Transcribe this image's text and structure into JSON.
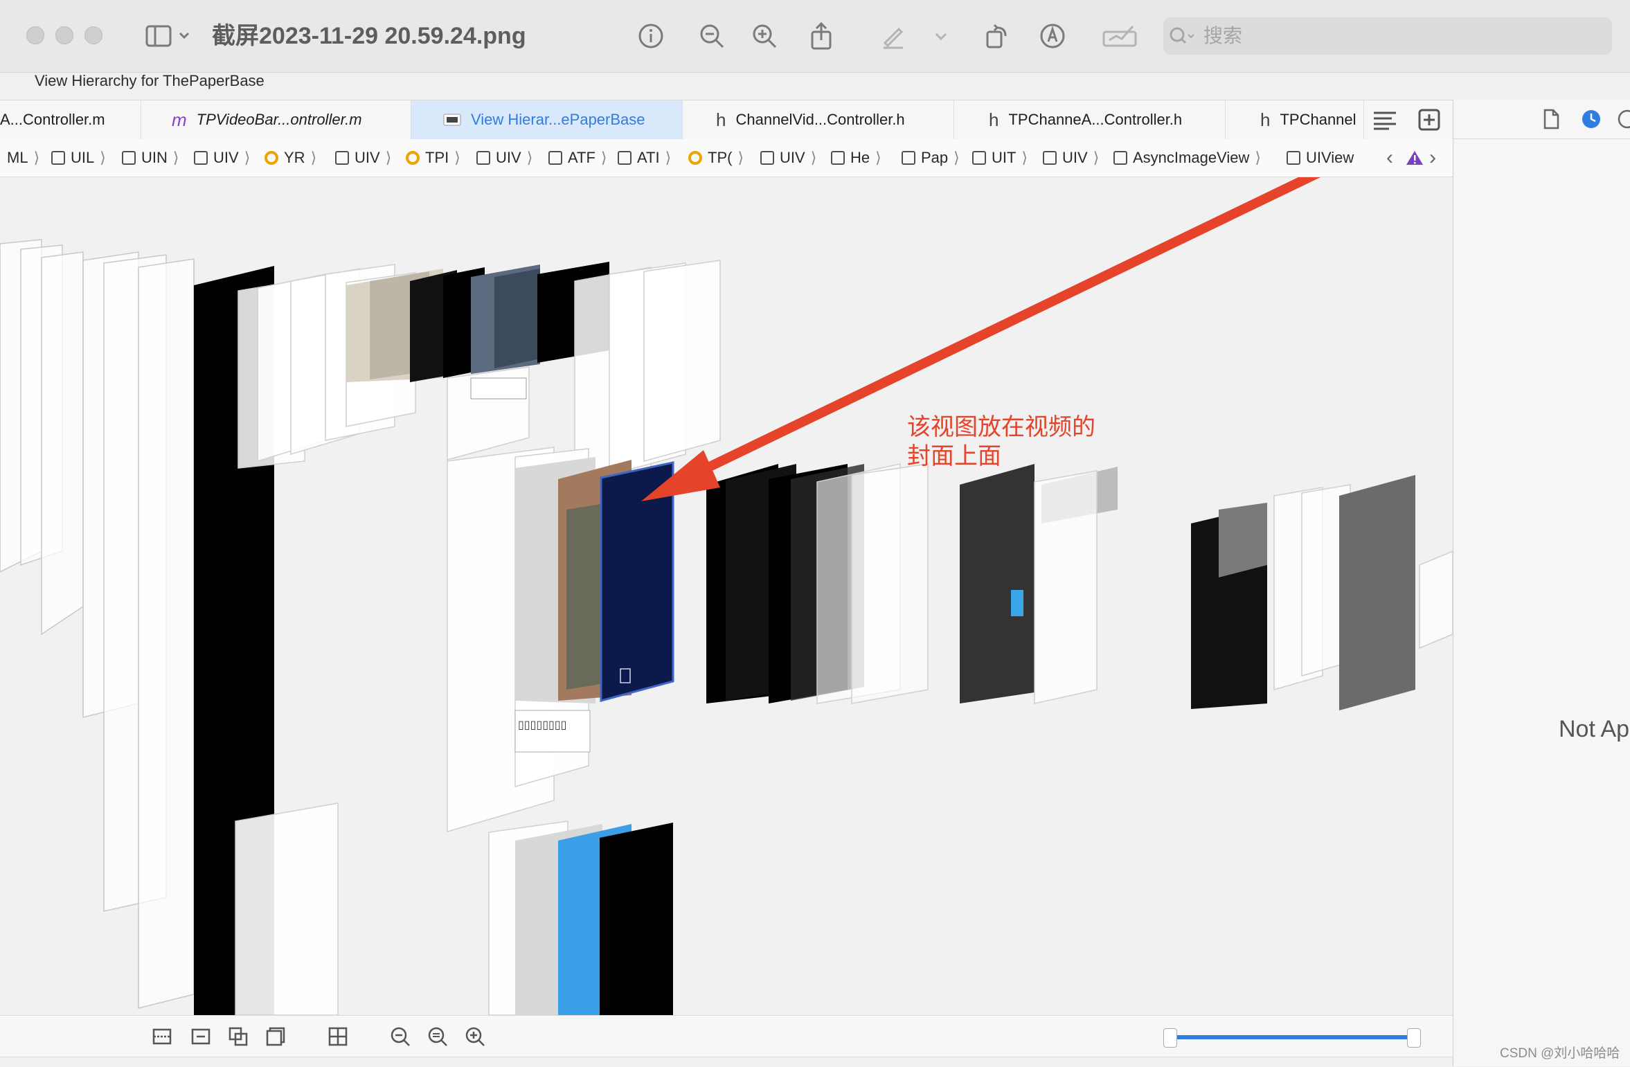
{
  "window": {
    "file_title": "截屏2023-11-29 20.59.24.png",
    "search_placeholder": "搜索",
    "subtitle": "View Hierarchy for ThePaperBase"
  },
  "tabs": [
    {
      "icon": "",
      "label": "A...Controller.m"
    },
    {
      "icon": "m",
      "label": "TPVideoBar...ontroller.m"
    },
    {
      "icon": "",
      "label": "View Hierar...ePaperBase"
    },
    {
      "icon": "h",
      "label": "ChannelVid...Controller.h"
    },
    {
      "icon": "h",
      "label": "TPChanneA...Controller.h"
    },
    {
      "icon": "h",
      "label": "TPChannel"
    }
  ],
  "breadcrumbs": [
    "ML",
    "UIL",
    "UIN",
    "UIV",
    "YR",
    "UIV",
    "TPI",
    "UIV",
    "ATF",
    "ATI",
    "TP(",
    "UIV",
    "He",
    "Pap",
    "UIT",
    "UIV",
    "AsyncImageView",
    "UIView"
  ],
  "annotation": {
    "line1": "该视图放在视频的",
    "line2": "封面上面",
    "color": "#e5432a"
  },
  "inspector": {
    "not_applicable": "Not Ap"
  },
  "watermark": "CSDN @刘小哈哈哈",
  "colors": {
    "accent": "#2f7de1",
    "arrow": "#e5432a",
    "highlight_view": "#0b1a4a"
  }
}
